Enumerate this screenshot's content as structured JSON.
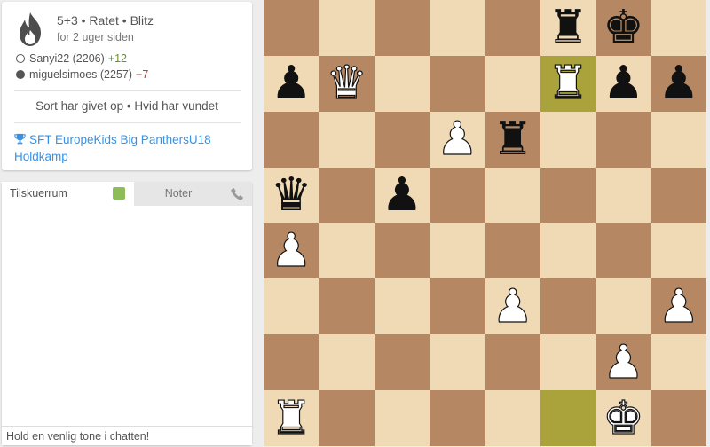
{
  "game": {
    "speed": "5+3 • Ratet • Blitz",
    "ago": "for 2 uger siden",
    "white_player": "Sanyi22 (2206)",
    "white_diff": "+12",
    "black_player": "miguelsimoes (2257)",
    "black_diff": "−7",
    "status": "Sort har givet op • Hvid har vundet",
    "tournament": "SFT EuropeKids Big PanthersU18 Holdkamp",
    "icons": {
      "variant": "fire-icon",
      "tournament": "trophy-icon"
    },
    "colors": {
      "link": "#3692e7",
      "plus": "#629924",
      "minus": "#cc3333"
    }
  },
  "chat": {
    "tab_chat": "Tilskuerrum",
    "tab_notes": "Noter",
    "toggle_on": true,
    "input_placeholder": "Hold en venlig tone i chatten!",
    "icons": {
      "voice": "phone-icon"
    },
    "toggle_color": "#8cbd58"
  },
  "board": {
    "orientation": "white",
    "colors": {
      "light": "#f0d9b5",
      "dark": "#b58863",
      "last_move_light": "#cdd26a",
      "last_move_dark": "#aaa23a"
    },
    "last_move": [
      "f1",
      "f7"
    ],
    "pieces": [
      {
        "square": "f8",
        "color": "b",
        "type": "rook"
      },
      {
        "square": "g8",
        "color": "b",
        "type": "king"
      },
      {
        "square": "a7",
        "color": "b",
        "type": "pawn"
      },
      {
        "square": "b7",
        "color": "w",
        "type": "queen"
      },
      {
        "square": "f7",
        "color": "w",
        "type": "rook"
      },
      {
        "square": "g7",
        "color": "b",
        "type": "pawn"
      },
      {
        "square": "h7",
        "color": "b",
        "type": "pawn"
      },
      {
        "square": "d6",
        "color": "w",
        "type": "pawn"
      },
      {
        "square": "e6",
        "color": "b",
        "type": "rook"
      },
      {
        "square": "a5",
        "color": "b",
        "type": "queen"
      },
      {
        "square": "c5",
        "color": "b",
        "type": "pawn"
      },
      {
        "square": "a4",
        "color": "w",
        "type": "pawn"
      },
      {
        "square": "e3",
        "color": "w",
        "type": "pawn"
      },
      {
        "square": "h3",
        "color": "w",
        "type": "pawn"
      },
      {
        "square": "g2",
        "color": "w",
        "type": "pawn"
      },
      {
        "square": "a1",
        "color": "w",
        "type": "rook"
      },
      {
        "square": "g1",
        "color": "w",
        "type": "king"
      }
    ]
  }
}
